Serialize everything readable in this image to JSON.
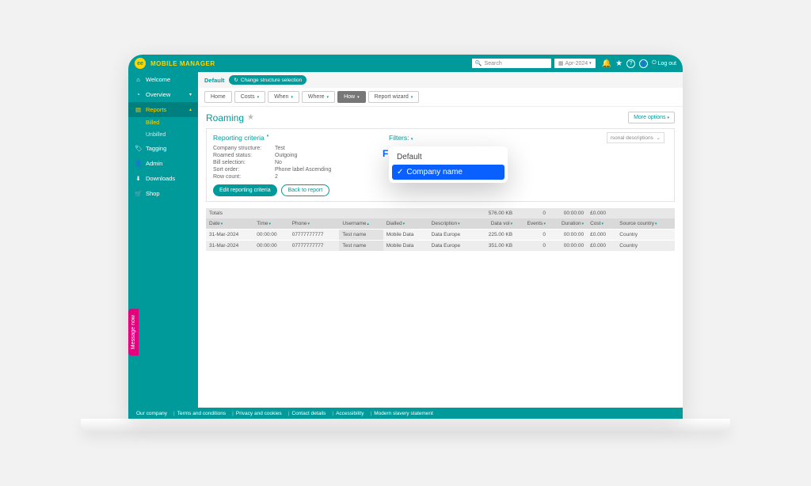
{
  "brand": "MOBILE MANAGER",
  "logo": "ee",
  "search": {
    "placeholder": "Search"
  },
  "month": "Apr-2024",
  "logout": "Log out",
  "sidebar": {
    "welcome": "Welcome",
    "overview": "Overview",
    "reports": "Reports",
    "billed": "Billed",
    "unbilled": "Unbilled",
    "tagging": "Tagging",
    "admin": "Admin",
    "downloads": "Downloads",
    "shop": "Shop"
  },
  "message_tab": "Message now",
  "crumb": {
    "default": "Default",
    "change": "Change structure selection"
  },
  "tabs": {
    "home": "Home",
    "costs": "Costs",
    "when": "When",
    "where": "Where",
    "how": "How",
    "wizard": "Report wizard"
  },
  "page": {
    "title": "Roaming",
    "more": "More options"
  },
  "criteria": {
    "head": "Reporting criteria",
    "filters": "Filters:",
    "rows": {
      "company_structure_l": "Company structure:",
      "company_structure_v": "Test",
      "roamed_status_l": "Roamed status:",
      "roamed_status_v": "Outgoing",
      "bill_selection_l": "Bill selection:",
      "bill_selection_v": "No",
      "sort_order_l": "Sort order:",
      "sort_order_v": "Phone label Ascending",
      "row_count_l": "Row count:",
      "row_count_v": "2"
    },
    "edit": "Edit reporting criteria",
    "back": "Back to report",
    "desc_select": "rsonal descriptions"
  },
  "popover": {
    "default": "Default",
    "company": "Company name"
  },
  "table": {
    "totals_label": "Totals",
    "totals": {
      "data_vol": "576.00 KB",
      "events": "0",
      "duration": "00:00:00",
      "cost": "£0.000"
    },
    "cols": {
      "date": "Date",
      "time": "Time",
      "phone": "Phone",
      "username": "Username",
      "dialled": "Dialled",
      "description": "Description",
      "data_vol": "Data vol",
      "events": "Events",
      "duration": "Duration",
      "cost": "Cost",
      "source": "Source country"
    },
    "rows": [
      {
        "date": "31-Mar-2024",
        "time": "00:00:00",
        "phone": "07777777777",
        "username": "Test name",
        "dialled": "Mobile Data",
        "description": "Data Europe",
        "data_vol": "225.00 KB",
        "events": "0",
        "duration": "00:00:00",
        "cost": "£0.000",
        "source": "Country"
      },
      {
        "date": "31-Mar-2024",
        "time": "00:00:00",
        "phone": "07777777777",
        "username": "Test name",
        "dialled": "Mobile Data",
        "description": "Data Europe",
        "data_vol": "351.00 KB",
        "events": "0",
        "duration": "00:00:00",
        "cost": "£0.000",
        "source": "Country"
      }
    ]
  },
  "footer": {
    "company": "Our company",
    "terms": "Terms and conditions",
    "privacy": "Privacy and cookies",
    "contact": "Contact details",
    "access": "Accessibility",
    "slavery": "Modern slavery statement"
  }
}
